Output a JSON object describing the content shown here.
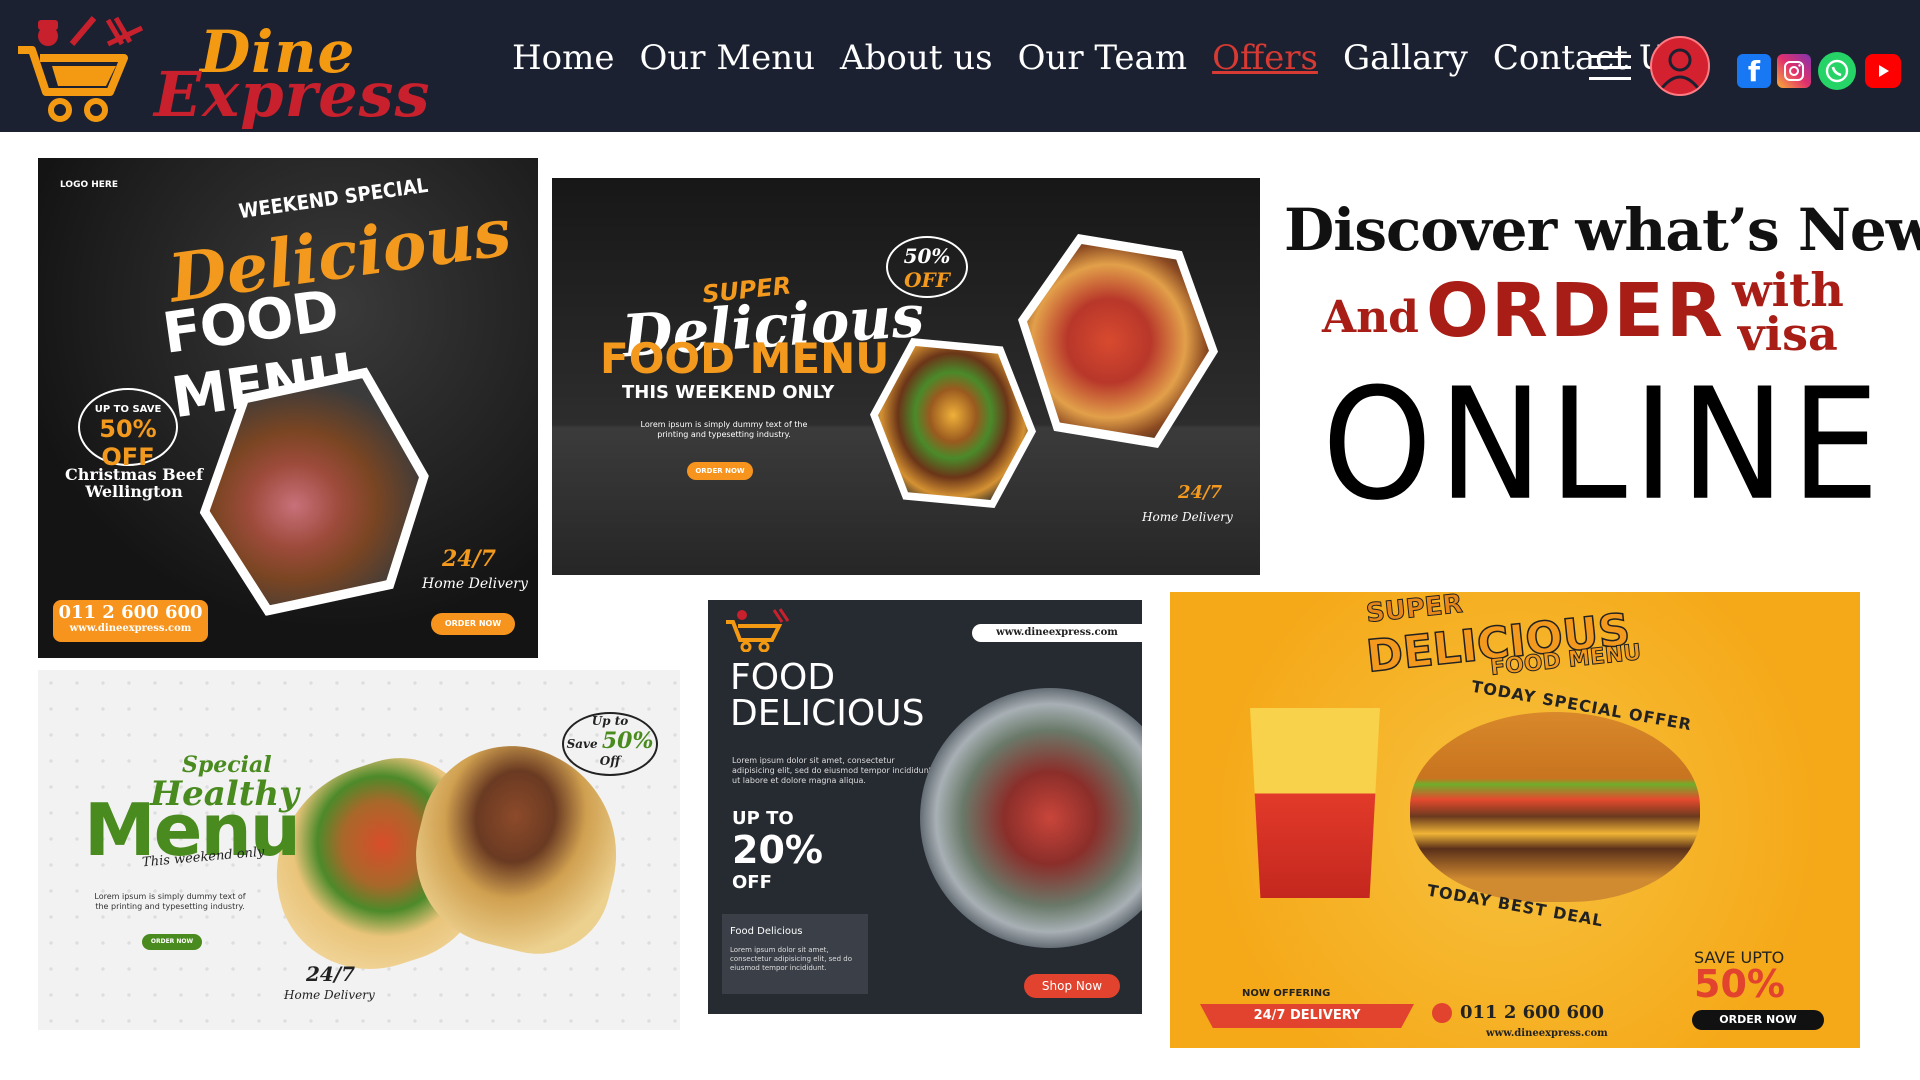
{
  "brand": {
    "line1": "Dine",
    "line2": "Express",
    "color_primary": "#f39a12",
    "color_secondary": "#c8202c"
  },
  "nav": {
    "items": [
      {
        "label": "Home",
        "active": false
      },
      {
        "label": "Our Menu",
        "active": false
      },
      {
        "label": "About us",
        "active": false
      },
      {
        "label": "Our Team",
        "active": false
      },
      {
        "label": "Offers",
        "active": true
      },
      {
        "label": "Gallary",
        "active": false
      },
      {
        "label": "Contact Us",
        "active": false
      }
    ],
    "menu_icon": "hamburger-icon",
    "user_icon": "user-icon",
    "social": [
      "facebook-icon",
      "instagram-icon",
      "whatsapp-icon",
      "youtube-icon"
    ],
    "fb_glyph": "f",
    "background": "#1b2131",
    "active_color": "#d63a32"
  },
  "banner1": {
    "logo": "LOGO HERE",
    "weekend": "WEEKEND SPECIAL",
    "delicious": "Delicious",
    "food_menu": "FOOD MENU",
    "save_small": "UP TO SAVE",
    "save_big": "50% OFF",
    "dish": "Christmas Beef Wellington",
    "hours": "24/7",
    "delivery": "Home Delivery",
    "phone": "011 2 600 600",
    "url": "www.dineexpress.com",
    "order": "ORDER NOW"
  },
  "banner2": {
    "super": "SUPER",
    "delicious": "Delicious",
    "food_menu": "FOOD MENU",
    "this_weekend": "THIS WEEKEND ONLY",
    "lorem": "Lorem ipsum is simply dummy text of the printing and typesetting industry.",
    "order": "ORDER NOW",
    "off_pct": "50%",
    "off_label": "OFF",
    "hours": "24/7",
    "delivery": "Home Delivery"
  },
  "promo": {
    "line1": "Discover what’s New",
    "and": "And",
    "order": "ORDER",
    "with": "with",
    "visa": "visa",
    "online": "ONLINE"
  },
  "banner4": {
    "special": "Special",
    "healthy": "Healthy",
    "menu": "Menu",
    "this_weekend": "This weekend only",
    "lorem": "Lorem ipsum is simply dummy text of the printing and typesetting industry.",
    "order": "ORDER NOW",
    "hours": "24/7",
    "delivery": "Home Delivery",
    "save_top": "Up to",
    "save_label": "Save",
    "save_pct": "50%",
    "save_off": "Off"
  },
  "banner5": {
    "url": "www.dineexpress.com",
    "title1": "FOOD",
    "title2": "DELICIOUS",
    "desc": "Lorem ipsum dolor sit amet, consectetur adipisicing elit, sed do eiusmod tempor incididunt ut labore et dolore magna aliqua.",
    "upto": "UP TO",
    "pct": "20%",
    "off": "OFF",
    "box_title": "Food Delicious",
    "box_desc": "Lorem ipsum dolor sit amet, consectetur adipisicing elit, sed do eiusmod tempor incididunt.",
    "shop": "Shop Now"
  },
  "banner6": {
    "super": "SUPER",
    "delicious": "DELICIOUS",
    "food_menu": "FOOD MENU",
    "today_special": "TODAY SPECIAL OFFER",
    "today_best": "TODAY BEST DEAL",
    "now_offering": "NOW OFFERING",
    "delivery": "24/7 DELIVERY",
    "phone": "011 2 600 600",
    "url": "www.dineexpress.com",
    "save_upto": "SAVE UPTO",
    "save_pct": "50%",
    "order": "ORDER NOW"
  }
}
